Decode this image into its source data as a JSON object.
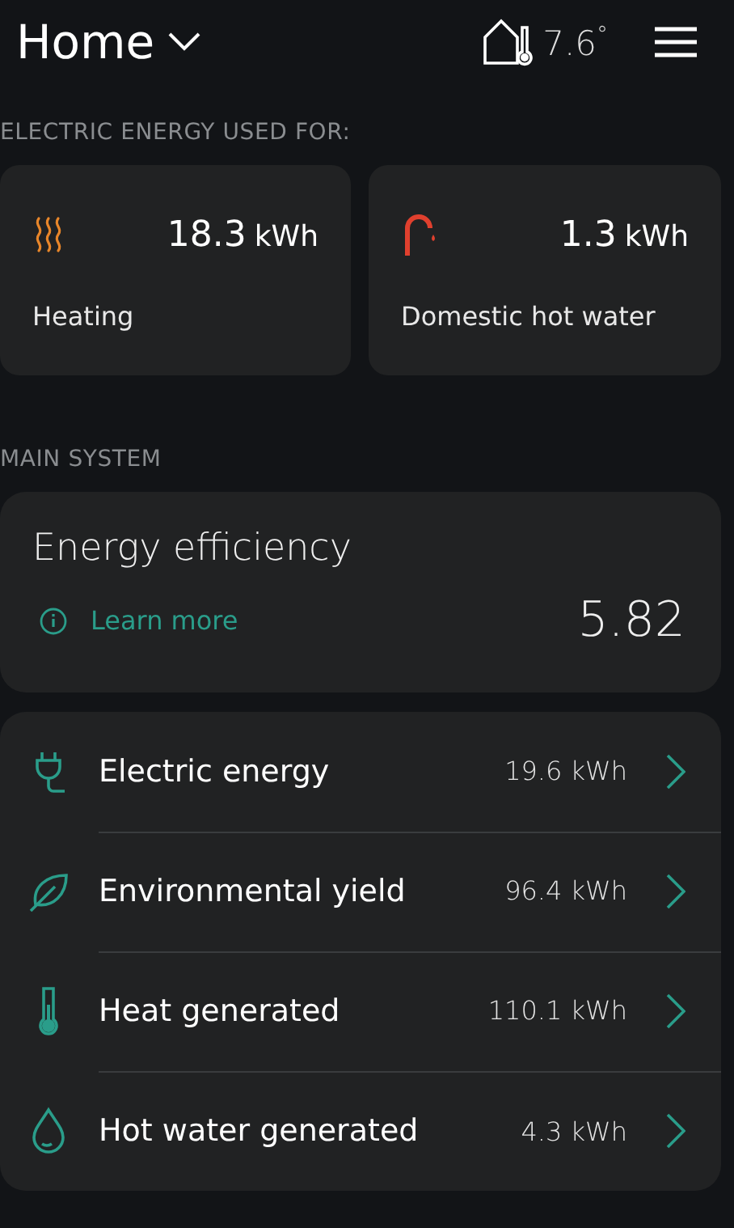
{
  "header": {
    "title": "Home",
    "temperature": "7.6$^{°}$"
  },
  "usage_section": {
    "label": "ELECTRIC ENERGY USED FOR:",
    "cards": [
      {
        "kind": "heating",
        "value": "18.3",
        "unit": "kWh",
        "label": "Heating"
      },
      {
        "kind": "tap",
        "value": "1.3",
        "unit": "kWh",
        "label": "Domestic hot water"
      }
    ]
  },
  "main_section": {
    "label": "MAIN SYSTEM",
    "efficiency": {
      "title": "Energy efficiency",
      "link": "Learn more",
      "value": "5.82"
    },
    "rows": [
      {
        "kind": "plug",
        "label": "Electric energy",
        "value": "19.6 kWh"
      },
      {
        "kind": "leaf",
        "label": "Environmental yield",
        "value": "96.4 kWh"
      },
      {
        "kind": "thermometer",
        "label": "Heat generated",
        "value": "110.1 kWh"
      },
      {
        "kind": "drop",
        "label": "Hot water generated",
        "value": "4.3 kWh"
      }
    ]
  }
}
